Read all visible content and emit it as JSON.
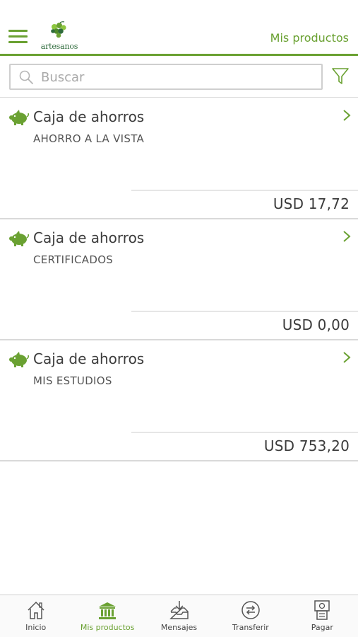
{
  "header": {
    "title": "Mis productos",
    "logo_text": "artesanos"
  },
  "search": {
    "placeholder": "Buscar",
    "value": ""
  },
  "products": [
    {
      "type": "Caja de ahorros",
      "name": "AHORRO A LA VISTA",
      "amount": "USD 17,72",
      "icon": "piggy-bank-icon"
    },
    {
      "type": "Caja de ahorros",
      "name": "CERTIFICADOS",
      "amount": "USD 0,00",
      "icon": "piggy-bank-icon"
    },
    {
      "type": "Caja de ahorros",
      "name": "MIS ESTUDIOS",
      "amount": "USD 753,20",
      "icon": "piggy-bank-icon"
    }
  ],
  "tabbar": {
    "items": [
      {
        "label": "Inicio",
        "icon": "home-icon",
        "active": false
      },
      {
        "label": "Mis productos",
        "icon": "bank-icon",
        "active": true
      },
      {
        "label": "Mensajes",
        "icon": "inbox-download-icon",
        "active": false
      },
      {
        "label": "Transferir",
        "icon": "transfer-icon",
        "active": false
      },
      {
        "label": "Pagar",
        "icon": "payment-icon",
        "active": false
      }
    ]
  },
  "colors": {
    "brand_green": "#6aa132",
    "text_dark": "#3c3c3c",
    "divider": "#d9d9d9"
  }
}
